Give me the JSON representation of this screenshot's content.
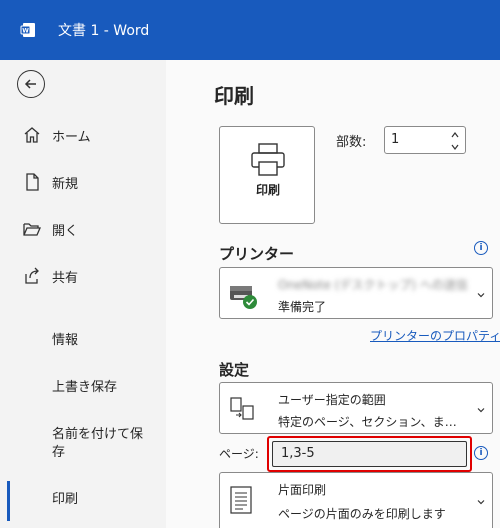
{
  "titlebar": {
    "title": "文書 1  -  Word"
  },
  "sidebar": {
    "home": "ホーム",
    "new": "新規",
    "open": "開く",
    "share": "共有",
    "info": "情報",
    "save": "上書き保存",
    "save_as": "名前を付けて保存",
    "print": "印刷"
  },
  "main": {
    "title": "印刷",
    "print_button": "印刷",
    "copies_label": "部数:",
    "copies_value": "1",
    "printer_section": "プリンター",
    "printer_name": "OneNote (デスクトップ) への送信",
    "printer_status": "準備完了",
    "printer_properties": "プリンターのプロパティ",
    "settings_section": "設定",
    "range_title": "ユーザー指定の範囲",
    "range_desc": "特定のページ、セクション、または…",
    "pages_label": "ページ:",
    "pages_value": "1,3-5",
    "sides_title": "片面印刷",
    "sides_desc": "ページの片面のみを印刷します"
  },
  "colors": {
    "accent": "#185abd",
    "highlight": "#e00000"
  }
}
